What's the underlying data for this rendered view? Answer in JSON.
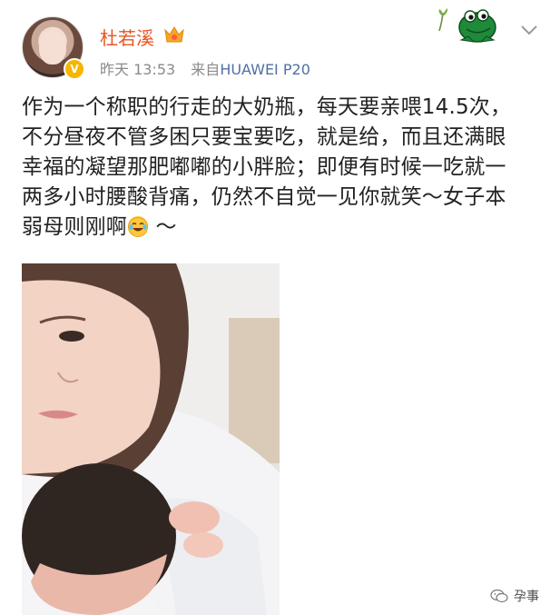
{
  "post": {
    "username": "杜若溪",
    "timestamp": "昨天 13:53",
    "source_prefix": "来自",
    "device": "HUAWEI P20",
    "text_lines": [
      "作为一个称职的行走的大奶瓶，每天要亲喂14.5次，",
      "不分昼夜不管多困只要宝要吃，就是给，而且还满眼",
      "幸福的凝望那肥嘟嘟的小胖脸；即便有时候一吃就一",
      "两多小时腰酸背痛，仍然不自觉一见你就笑～女子本"
    ],
    "last_line_text": "弱母则刚啊",
    "last_line_suffix": " ～",
    "emoji": "laughing-with-tears",
    "verified_badge": "V"
  },
  "footer": {
    "watermark_account": "孕事"
  },
  "colors": {
    "username": "#e8541f",
    "meta": "#8a8a8a",
    "device": "#516fa6",
    "badge": "#f7b500"
  }
}
